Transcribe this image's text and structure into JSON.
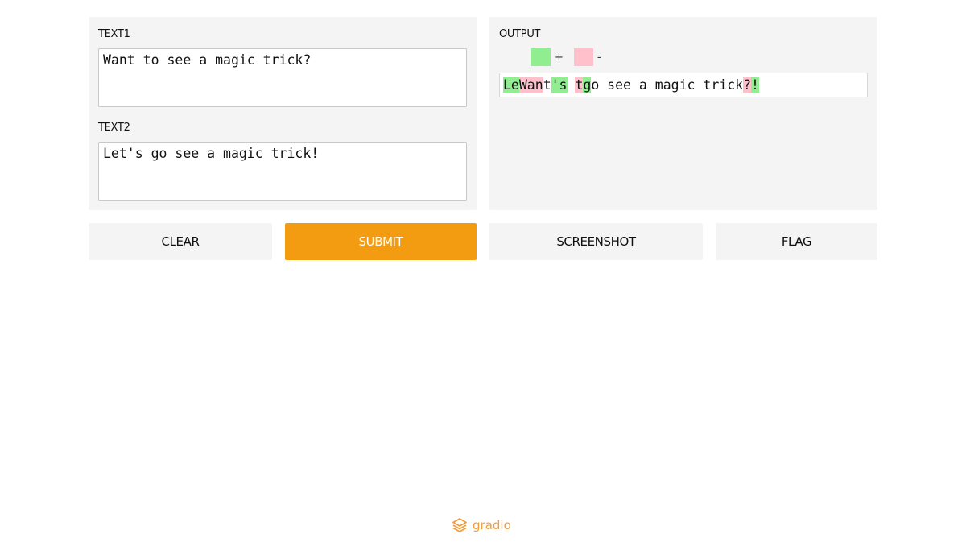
{
  "colors": {
    "panel_bg": "#f4f4f4",
    "submit_bg": "#f39c12",
    "added": "#90ee90",
    "removed": "#ffc0cb",
    "brand": "#f39c3c"
  },
  "inputs": {
    "text1": {
      "label": "TEXT1",
      "value": "Want to see a magic trick?"
    },
    "text2": {
      "label": "TEXT2",
      "value": "Let's go see a magic trick!"
    }
  },
  "output": {
    "label": "OUTPUT",
    "legend": {
      "added_symbol": "+",
      "removed_symbol": "-"
    },
    "diff_segments": [
      {
        "text": "Le",
        "type": "added"
      },
      {
        "text": "Wan",
        "type": "removed"
      },
      {
        "text": "t",
        "type": "same"
      },
      {
        "text": "'s",
        "type": "added"
      },
      {
        "text": " ",
        "type": "same"
      },
      {
        "text": "t",
        "type": "removed"
      },
      {
        "text": "g",
        "type": "added"
      },
      {
        "text": "o see a magic trick",
        "type": "same"
      },
      {
        "text": "?",
        "type": "removed"
      },
      {
        "text": "!",
        "type": "added"
      }
    ]
  },
  "buttons": {
    "clear": "CLEAR",
    "submit": "SUBMIT",
    "screenshot": "SCREENSHOT",
    "flag": "FLAG"
  },
  "footer": {
    "brand": "gradio",
    "icon": "gradio-logo-icon"
  }
}
